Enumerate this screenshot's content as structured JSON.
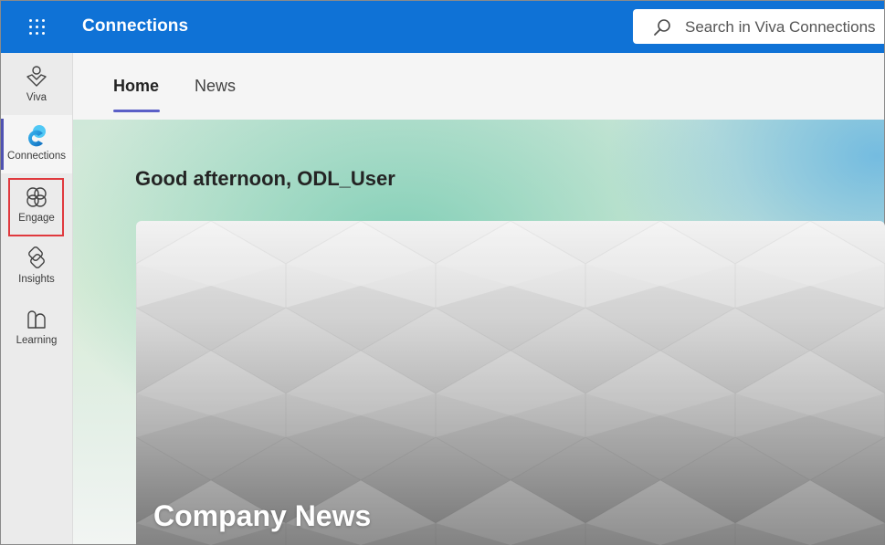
{
  "header": {
    "app_title": "Connections",
    "search_placeholder": "Search in Viva Connections",
    "waffle_icon": "app-launcher-icon",
    "brand_color": "#0f72d6"
  },
  "rail": {
    "items": [
      {
        "label": "Viva",
        "icon": "viva-icon"
      },
      {
        "label": "Connections",
        "icon": "connections-icon",
        "active": true
      },
      {
        "label": "Engage",
        "icon": "engage-icon",
        "highlighted": true
      },
      {
        "label": "Insights",
        "icon": "insights-icon"
      },
      {
        "label": "Learning",
        "icon": "learning-icon"
      }
    ],
    "highlight_color": "#e0393e",
    "active_color": "#4f52b2"
  },
  "tabs": [
    {
      "label": "Home",
      "selected": true
    },
    {
      "label": "News",
      "selected": false
    }
  ],
  "greeting": "Good afternoon, ODL_User",
  "news_card": {
    "title": "Company News"
  }
}
